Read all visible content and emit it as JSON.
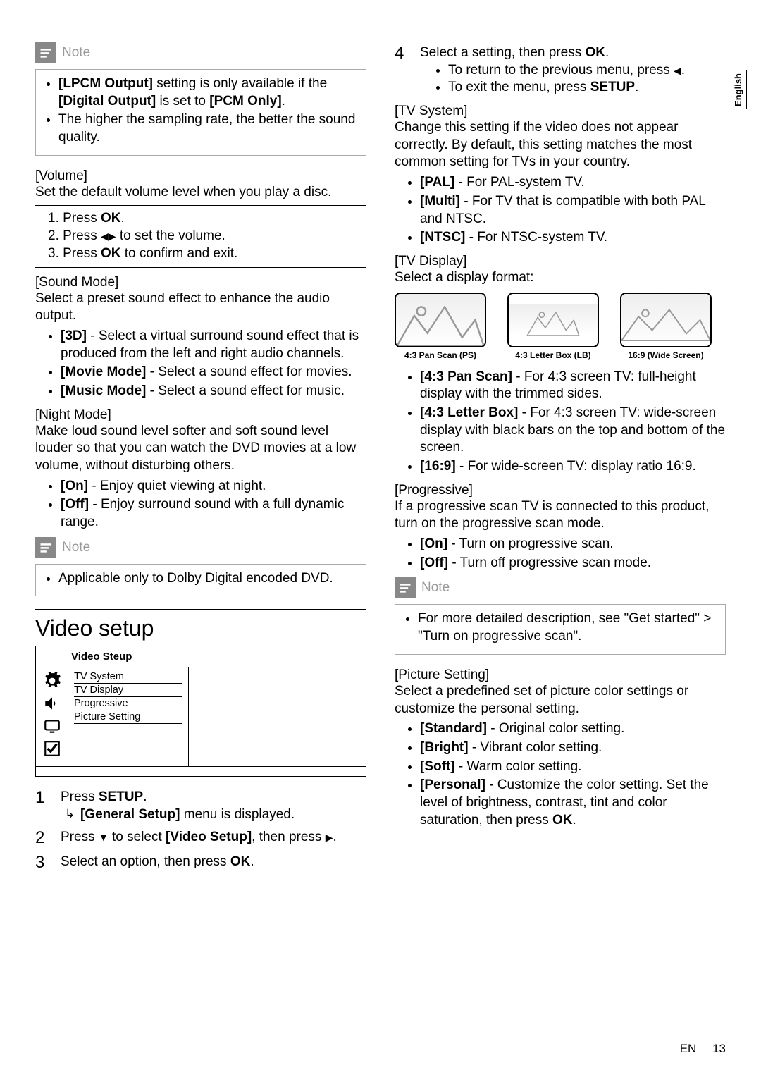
{
  "side_tab": "English",
  "col1": {
    "note1": {
      "title": "Note",
      "items": [
        {
          "prefix": "[LPCM Output]",
          "mid": " setting is only available if the ",
          "bold2": "[Digital Output]",
          "mid2": " is set to ",
          "bold3": "[PCM Only]",
          "suffix": "."
        },
        {
          "text": "The higher the sampling rate, the better the sound quality."
        }
      ]
    },
    "volume": {
      "heading": "[Volume]",
      "desc": "Set the default volume level when you play a disc.",
      "steps": {
        "s1a": "1. Press ",
        "s1b": "OK",
        "s1c": ".",
        "s2a": "2. Press ",
        "s2c": " to set the volume.",
        "s3a": "3. Press ",
        "s3b": "OK",
        "s3c": " to confirm and exit."
      }
    },
    "sound_mode": {
      "heading": "[Sound Mode]",
      "desc": "Select a preset sound effect to enhance the audio output.",
      "opts": [
        {
          "k": "[3D]",
          "v": " - Select a virtual surround sound effect that is produced from the left and right audio channels."
        },
        {
          "k": "[Movie Mode]",
          "v": " - Select a sound effect for movies."
        },
        {
          "k": "[Music Mode]",
          "v": " - Select a sound effect for music."
        }
      ]
    },
    "night_mode": {
      "heading": "[Night Mode]",
      "desc": "Make loud sound level softer and soft sound level louder so that you can watch the DVD movies at a low volume, without disturbing others.",
      "opts": [
        {
          "k": "[On]",
          "v": " - Enjoy quiet viewing at night."
        },
        {
          "k": "[Off]",
          "v": " - Enjoy surround sound with a full dynamic range."
        }
      ]
    },
    "note2": {
      "title": "Note",
      "item": "Applicable only to Dolby Digital encoded DVD."
    },
    "video_setup": {
      "heading": "Video setup",
      "menu": {
        "title": "Video Steup",
        "items": [
          "TV System",
          "TV Display",
          "Progressive",
          "Picture Setting"
        ]
      },
      "steps": {
        "s1a": "Press ",
        "s1b": "SETUP",
        "s1c": ".",
        "s1sub_a": "[General Setup]",
        "s1sub_b": " menu is displayed.",
        "s2a": "Press ",
        "s2b": " to select ",
        "s2c": "[Video Setup]",
        "s2d": ", then press ",
        "s2e": ".",
        "s3a": "Select an option, then press ",
        "s3b": "OK",
        "s3c": "."
      }
    }
  },
  "col2": {
    "step4": {
      "a": "Select a setting, then press ",
      "b": "OK",
      "c": ".",
      "sub1a": "To return to the previous menu, press ",
      "sub1b": ".",
      "sub2a": "To exit the menu, press ",
      "sub2b": "SETUP",
      "sub2c": "."
    },
    "tv_system": {
      "heading": "[TV System]",
      "desc": "Change this setting if the video does not appear correctly. By default, this setting matches the most common setting for TVs in your country.",
      "opts": [
        {
          "k": "[PAL]",
          "v": " - For PAL-system TV."
        },
        {
          "k": "[Multi]",
          "v": " - For TV that is compatible with both PAL and NTSC."
        },
        {
          "k": "[NTSC]",
          "v": " - For NTSC-system TV."
        }
      ]
    },
    "tv_display": {
      "heading": "[TV Display]",
      "desc": "Select a display format:",
      "labels": [
        "4:3 Pan Scan (PS)",
        "4:3 Letter Box (LB)",
        "16:9 (Wide Screen)"
      ],
      "opts": [
        {
          "k": "[4:3 Pan Scan]",
          "v": " - For 4:3 screen TV: full-height display with the trimmed sides."
        },
        {
          "k": "[4:3 Letter Box]",
          "v": " - For 4:3 screen TV: wide-screen display with black bars on the top and bottom of the screen."
        },
        {
          "k": "[16:9]",
          "v": " - For wide-screen TV: display ratio 16:9."
        }
      ]
    },
    "progressive": {
      "heading": "[Progressive]",
      "desc": "If a progressive scan TV is connected to this product, turn on the progressive scan mode.",
      "opts": [
        {
          "k": "[On]",
          "v": " - Turn on progressive scan."
        },
        {
          "k": "[Off]",
          "v": " - Turn off progressive scan mode."
        }
      ]
    },
    "note3": {
      "title": "Note",
      "item": "For more detailed description, see \"Get started\" > \"Turn on progressive scan\"."
    },
    "picture_setting": {
      "heading": "[Picture Setting]",
      "desc": "Select a predefined set of picture color settings or customize the personal setting.",
      "opts": [
        {
          "k": "[Standard]",
          "v": " - Original color setting."
        },
        {
          "k": "[Bright]",
          "v": " - Vibrant color setting."
        },
        {
          "k": "[Soft]",
          "v": " - Warm color setting."
        },
        {
          "k": "[Personal]",
          "v_a": " - Customize the color setting. Set the level of brightness, contrast, tint and color saturation, then press ",
          "v_b": "OK",
          "v_c": "."
        }
      ]
    }
  },
  "footer": {
    "en": "EN",
    "page": "13"
  }
}
